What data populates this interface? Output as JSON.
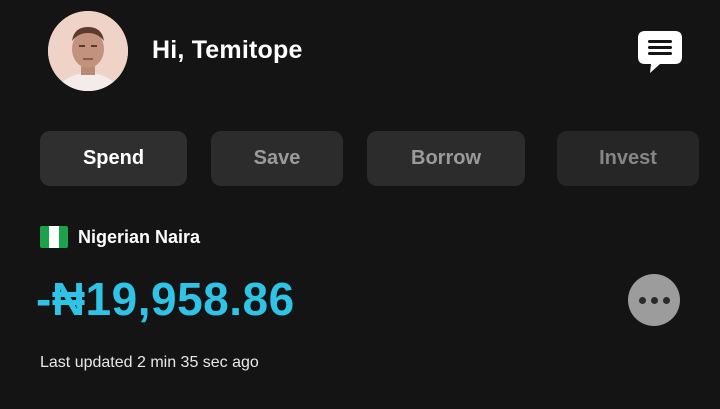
{
  "header": {
    "greeting": "Hi, Temitope",
    "avatar_icon": "user-photo",
    "chat_icon": "chat-bubble-icon"
  },
  "tabs": [
    {
      "label": "Spend",
      "active": true
    },
    {
      "label": "Save",
      "active": false
    },
    {
      "label": "Borrow",
      "active": false
    },
    {
      "label": "Invest",
      "active": false
    }
  ],
  "account": {
    "currency_name": "Nigerian Naira",
    "flag_icon": "nigeria-flag-icon",
    "balance": "-₦19,958.86",
    "last_updated": "Last updated 2 min 35 sec ago",
    "more_icon": "more-dots-icon"
  },
  "colors": {
    "background": "#141414",
    "tab_background": "#2c2c2c",
    "balance_accent": "#2fc3e6",
    "more_button": "#9c9c9c"
  }
}
